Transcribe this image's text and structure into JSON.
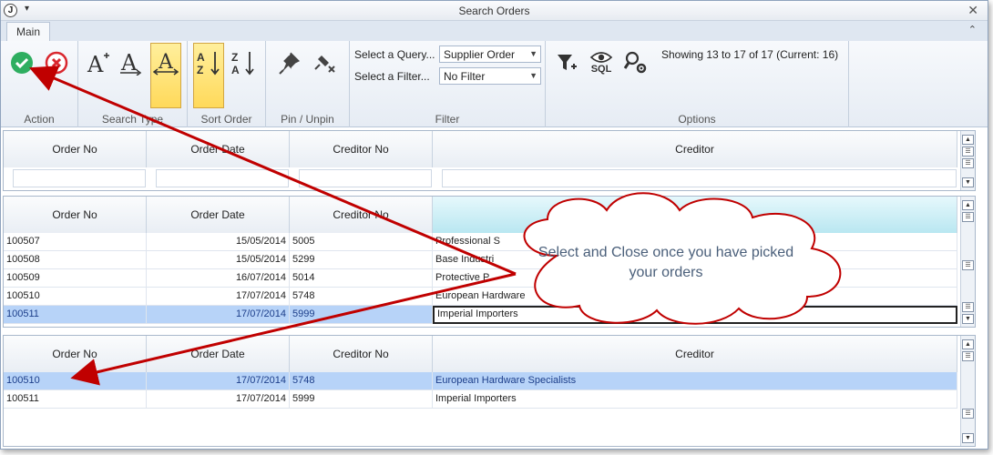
{
  "window": {
    "title": "Search Orders",
    "app_icon": "J"
  },
  "tabs": [
    {
      "label": "Main"
    }
  ],
  "ribbon": {
    "groups": {
      "action": "Action",
      "search_type": "Search Type",
      "sort_order": "Sort Order",
      "pin_unpin": "Pin / Unpin",
      "filter": "Filter",
      "options": "Options"
    },
    "select_query_label": "Select a Query...",
    "select_query_value": "Supplier Order",
    "select_filter_label": "Select a Filter...",
    "select_filter_value": "No Filter",
    "status_text": "Showing 13 to 17 of 17 (Current: 16)",
    "sql_label": "SQL",
    "sort_az": "AZ",
    "sort_za": "ZA"
  },
  "columns": [
    "Order No",
    "Order Date",
    "Creditor No",
    "Creditor"
  ],
  "results": [
    {
      "order": "100507",
      "date": "15/05/2014",
      "cred_no": "5005",
      "creditor": "Professional S"
    },
    {
      "order": "100508",
      "date": "15/05/2014",
      "cred_no": "5299",
      "creditor": "Base Industri"
    },
    {
      "order": "100509",
      "date": "16/07/2014",
      "cred_no": "5014",
      "creditor": "Protective P"
    },
    {
      "order": "100510",
      "date": "17/07/2014",
      "cred_no": "5748",
      "creditor": "European Hardware"
    },
    {
      "order": "100511",
      "date": "17/07/2014",
      "cred_no": "5999",
      "creditor": "Imperial Importers"
    }
  ],
  "selected": [
    {
      "order": "100510",
      "date": "17/07/2014",
      "cred_no": "5748",
      "creditor": "European Hardware Specialists"
    },
    {
      "order": "100511",
      "date": "17/07/2014",
      "cred_no": "5999",
      "creditor": "Imperial Importers"
    }
  ],
  "callout": {
    "text": "Select and Close once you have picked your orders"
  },
  "colors": {
    "selected_row": "#b7d3f8",
    "active_button": "#ffd95a",
    "arrow": "#c00000"
  }
}
